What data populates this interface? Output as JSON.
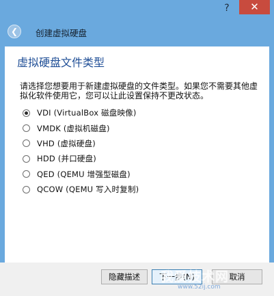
{
  "window": {
    "help_symbol": "?",
    "close_symbol": "✕",
    "back_symbol": "❮",
    "subtitle": "创建虚拟硬盘"
  },
  "page": {
    "heading": "虚拟硬盘文件类型",
    "description": "请选择您想要用于新建虚拟硬盘的文件类型。如果您不需要其他虚拟化软件使用它，您可以让此设置保持不更改状态。"
  },
  "options": [
    {
      "label": "VDI (VirtualBox 磁盘映像)",
      "checked": true
    },
    {
      "label": "VMDK (虚拟机磁盘)",
      "checked": false
    },
    {
      "label": "VHD (虚拟硬盘)",
      "checked": false
    },
    {
      "label": "HDD (并口硬盘)",
      "checked": false
    },
    {
      "label": "QED (QEMU 增强型磁盘)",
      "checked": false
    },
    {
      "label": "QCOW (QEMU 写入时复制)",
      "checked": false
    }
  ],
  "footer": {
    "hide_desc_label": "隐藏描述",
    "next_label": "下一步(N)",
    "cancel_label": "取消"
  },
  "watermark": {
    "text": "我爱技术网",
    "sub": "www.52ij.com"
  }
}
